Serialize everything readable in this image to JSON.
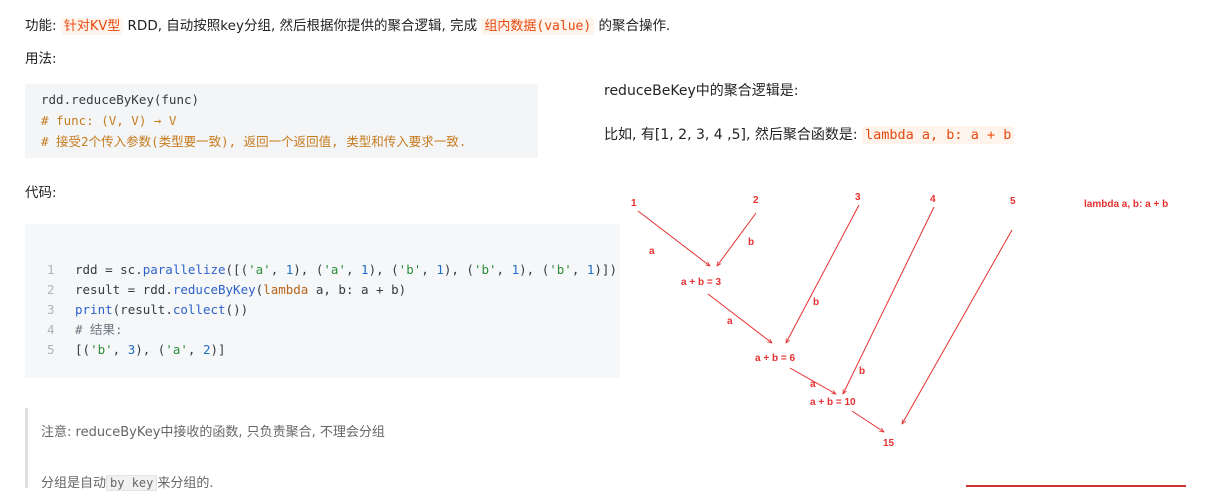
{
  "intro": {
    "prefix": "功能: ",
    "kv_highlight": "针对KV型",
    "middle": " RDD, 自动按照key分组, 然后根据你提供的聚合逻辑, 完成 ",
    "value_highlight": "组内数据(value)",
    "suffix": " 的聚合操作."
  },
  "usage_label": "用法:",
  "usage_code": {
    "line1": "rdd.reduceByKey(func)",
    "line2": "# func: (V, V) → V",
    "line3": "# 接受2个传入参数(类型要一致), 返回一个返回值, 类型和传入要求一致."
  },
  "code_label": "代码:",
  "code_lines": [
    {
      "num": "1"
    },
    {
      "num": "2"
    },
    {
      "num": "3"
    },
    {
      "num": "4",
      "comment": "# 结果:"
    },
    {
      "num": "5"
    }
  ],
  "note": {
    "line1": "注意: reduceByKey中接收的函数, 只负责聚合, 不理会分组",
    "line2_prefix": "分组是自动",
    "line2_code": "by key",
    "line2_suffix": "来分组的."
  },
  "right": {
    "title": "reduceBeKey中的聚合逻辑是:",
    "example_prefix": "比如, 有[1, 2, 3, 4 ,5], 然后聚合函数是: ",
    "example_code": "lambda a, b: a + b"
  },
  "diagram": {
    "accent": "#e53030",
    "inputs": [
      "1",
      "2",
      "3",
      "4",
      "5"
    ],
    "func_label": "lambda a, b: a + b",
    "steps": [
      "a + b = 3",
      "a + b = 6",
      "a + b = 10"
    ],
    "result": "15",
    "edge_labels": [
      "a",
      "b",
      "a",
      "b",
      "a",
      "b"
    ]
  }
}
